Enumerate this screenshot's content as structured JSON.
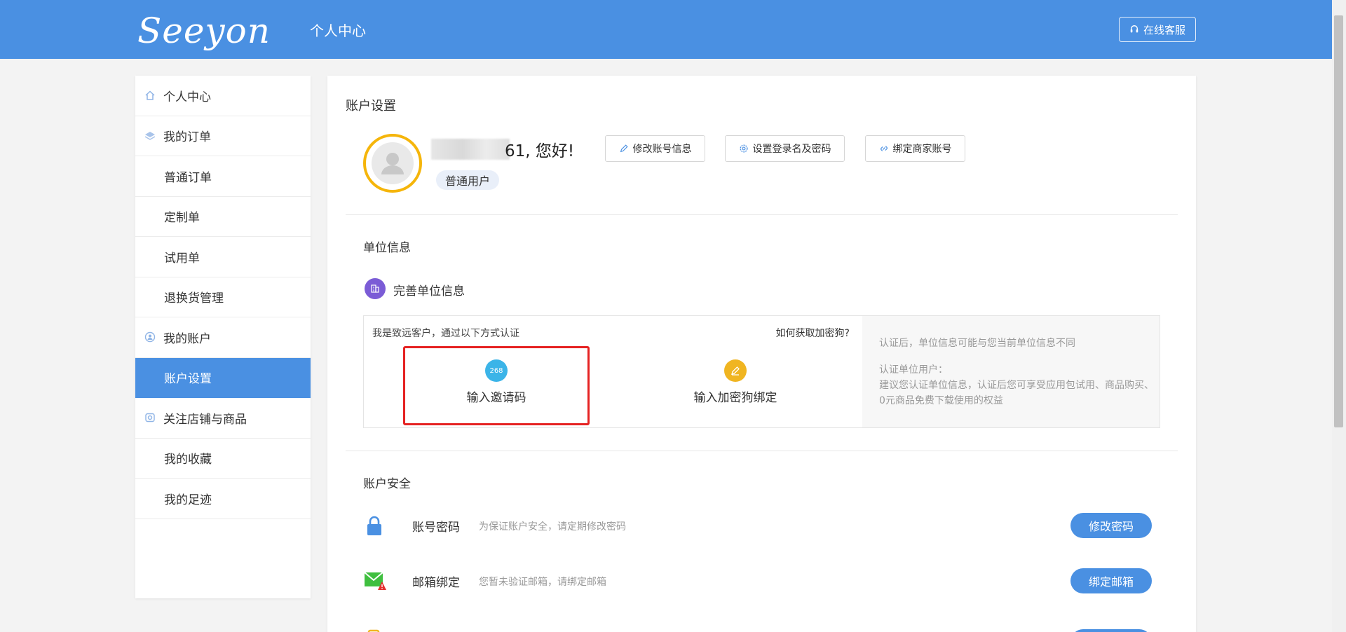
{
  "header": {
    "logo": "Seeyon",
    "title": "个人中心",
    "service_label": "在线客服"
  },
  "sidebar": {
    "items": [
      {
        "label": "个人中心"
      },
      {
        "label": "我的订单"
      },
      {
        "label": "普通订单"
      },
      {
        "label": "定制单"
      },
      {
        "label": "试用单"
      },
      {
        "label": "退换货管理"
      },
      {
        "label": "我的账户"
      },
      {
        "label": "账户设置"
      },
      {
        "label": "关注店铺与商品"
      },
      {
        "label": "我的收藏"
      },
      {
        "label": "我的足迹"
      }
    ]
  },
  "account": {
    "title": "账户设置",
    "greeting": "61, 您好!",
    "badge": "普通用户",
    "buttons": {
      "edit_info": "修改账号信息",
      "set_login": "设置登录名及密码",
      "bind_merchant": "绑定商家账号"
    }
  },
  "org": {
    "title": "单位信息",
    "complete_label": "完善单位信息",
    "auth_desc": "我是致远客户，通过以下方式认证",
    "auth_link": "如何获取加密狗?",
    "options": {
      "invite": {
        "label": "输入邀请码",
        "icon_text": "268"
      },
      "dongle": {
        "label": "输入加密狗绑定"
      }
    },
    "tips": {
      "line1": "认证后，单位信息可能与您当前单位信息不同",
      "line2": "认证单位用户：",
      "line3": "建议您认证单位信息，认证后您可享受应用包试用、商品购买、0元商品免费下载使用的权益"
    }
  },
  "security": {
    "title": "账户安全",
    "rows": [
      {
        "name": "账号密码",
        "desc": "为保证账户安全，请定期修改密码",
        "button": "修改密码"
      },
      {
        "name": "邮箱绑定",
        "desc": "您暂未验证邮箱，请绑定邮箱",
        "button": "绑定邮箱"
      }
    ]
  },
  "colors": {
    "brand": "#4a90e2",
    "avatar_ring": "#f5b50a",
    "highlight": "#e52222"
  }
}
